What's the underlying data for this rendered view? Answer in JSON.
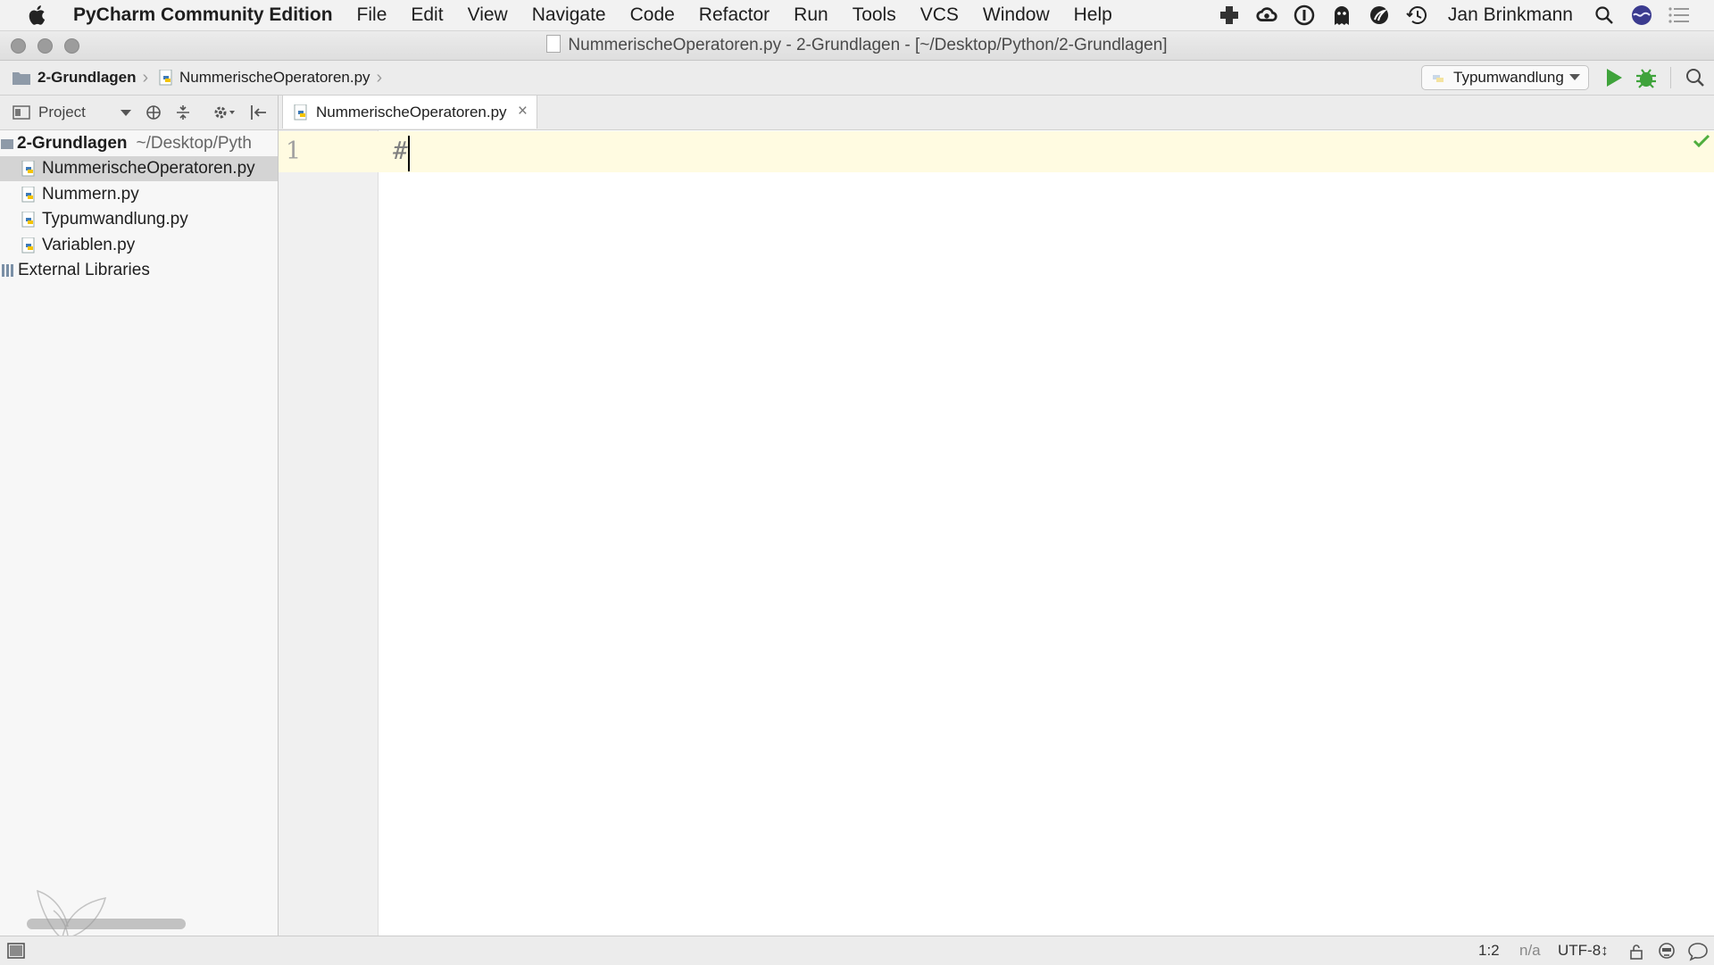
{
  "menubar": {
    "app_name": "PyCharm Community Edition",
    "items": [
      "File",
      "Edit",
      "View",
      "Navigate",
      "Code",
      "Refactor",
      "Run",
      "Tools",
      "VCS",
      "Window",
      "Help"
    ],
    "user_name": "Jan Brinkmann"
  },
  "window": {
    "title": "NummerischeOperatoren.py - 2-Grundlagen - [~/Desktop/Python/2-Grundlagen]"
  },
  "navbar": {
    "breadcrumbs": [
      "2-Grundlagen",
      "NummerischeOperatoren.py"
    ],
    "run_config": "Typumwandlung"
  },
  "project_panel": {
    "view_label": "Project",
    "root": {
      "name": "2-Grundlagen",
      "path": "~/Desktop/Pyth"
    },
    "files": [
      "NummerischeOperatoren.py",
      "Nummern.py",
      "Typumwandlung.py",
      "Variablen.py"
    ],
    "selected_file": "NummerischeOperatoren.py",
    "external": "External Libraries"
  },
  "editor": {
    "tab_label": "NummerischeOperatoren.py",
    "line_number": "1",
    "code": "#"
  },
  "statusbar": {
    "position": "1:2",
    "line_separator": "n/a",
    "encoding": "UTF-8↕"
  },
  "colors": {
    "run_green": "#3fa33b",
    "current_line": "#fffbe1",
    "selection": "#d4d4d4"
  }
}
